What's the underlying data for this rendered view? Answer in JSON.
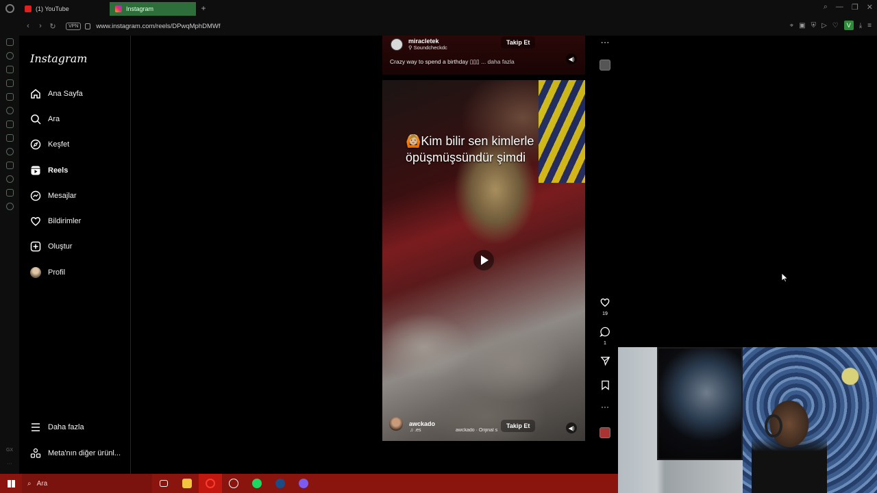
{
  "browser": {
    "tabs": [
      {
        "label": "(1) YouTube",
        "icon": "youtube-icon",
        "active": false
      },
      {
        "label": "Instagram",
        "icon": "instagram-icon",
        "active": true
      }
    ],
    "url": "www.instagram.com/reels/DPwqMphDMWf",
    "vpn_label": "VPN",
    "profile_badge": "V",
    "accent": "#2e6e3a"
  },
  "sidebar": {
    "logo": "Instagram",
    "items": [
      {
        "label": "Ana Sayfa",
        "icon": "home-icon"
      },
      {
        "label": "Ara",
        "icon": "search-icon"
      },
      {
        "label": "Keşfet",
        "icon": "compass-icon"
      },
      {
        "label": "Reels",
        "icon": "reels-icon",
        "active": true
      },
      {
        "label": "Mesajlar",
        "icon": "messenger-icon"
      },
      {
        "label": "Bildirimler",
        "icon": "heart-icon"
      },
      {
        "label": "Oluştur",
        "icon": "plus-square-icon"
      },
      {
        "label": "Profil",
        "icon": "avatar"
      }
    ],
    "more": "Daha fazla",
    "meta": "Meta'nın diğer ürünl..."
  },
  "reel_previous": {
    "username": "miracletek",
    "location": "Soundcheckdc",
    "follow": "Takip Et",
    "caption": "Crazy way to spend a birthday ▯▯▯",
    "caption_more": "... daha fazla"
  },
  "reel_current": {
    "overlay_text": "🙆🏼Kim bilir sen kimlerle öpüşmüşsündür şimdi",
    "username": "awckado",
    "audio_tag": "♫ .es",
    "audio_source": "awckado · Orijinal s",
    "follow": "Takip Et"
  },
  "actions": {
    "likes": "19",
    "comments": "1"
  },
  "taskbar": {
    "search_placeholder": "Ara"
  }
}
